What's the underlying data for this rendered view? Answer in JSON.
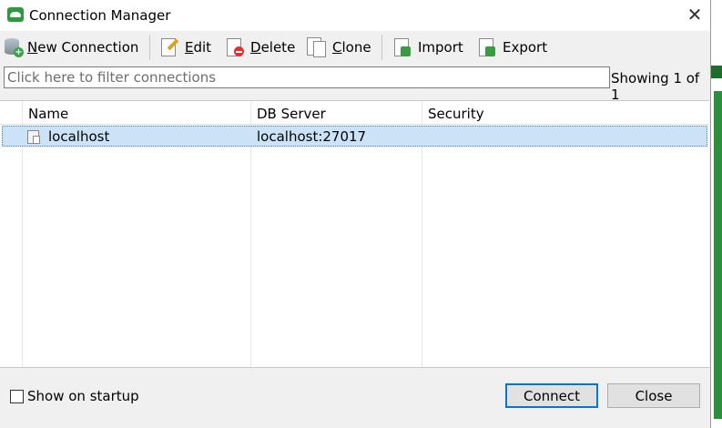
{
  "window": {
    "title": "Connection Manager",
    "close_glyph": "✕"
  },
  "toolbar": {
    "new_connection": {
      "prefix": "N",
      "rest": "ew Connection",
      "icon": "database-add-icon"
    },
    "edit": {
      "prefix": "E",
      "rest": "dit",
      "icon": "pencil-icon"
    },
    "delete": {
      "prefix": "D",
      "rest": "elete",
      "icon": "delete-icon"
    },
    "clone": {
      "prefix": "C",
      "rest": "lone",
      "icon": "copy-icon"
    },
    "import": {
      "label": "Import",
      "icon": "import-icon"
    },
    "export": {
      "label": "Export",
      "icon": "export-icon"
    }
  },
  "filter": {
    "placeholder": "Click here to filter connections",
    "value": "",
    "count_text": "Showing 1 of 1"
  },
  "table": {
    "columns": [
      "Name",
      "DB Server",
      "Security"
    ],
    "rows": [
      {
        "name": "localhost",
        "db_server": "localhost:27017",
        "security": ""
      }
    ]
  },
  "footer": {
    "show_on_startup": "Show on startup",
    "checked": false,
    "connect": "Connect",
    "close": "Close"
  },
  "colors": {
    "selection": "#cce3f7",
    "accent": "#0078d7",
    "brand": "#2e9a3f"
  }
}
